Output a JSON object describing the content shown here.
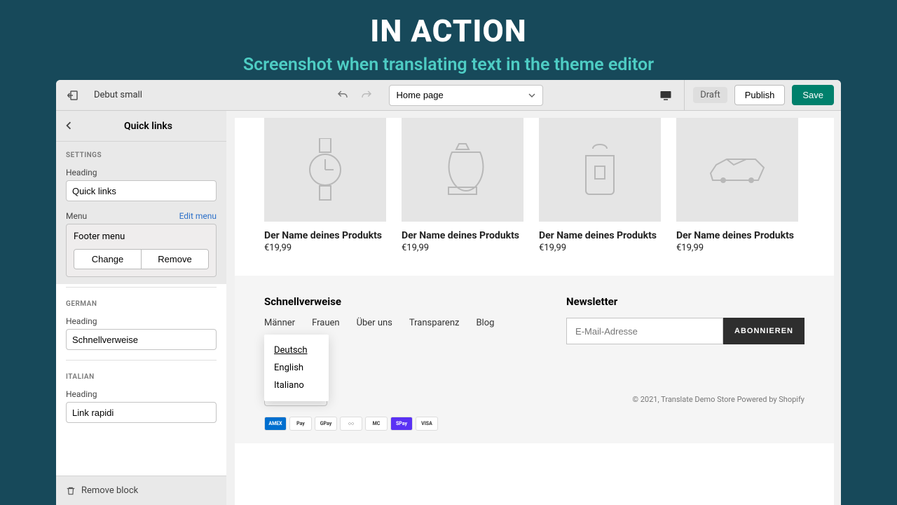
{
  "hero": {
    "title": "IN ACTION",
    "subtitle": "Screenshot when translating text in the theme editor"
  },
  "topbar": {
    "theme": "Debut small",
    "page": "Home page",
    "draft": "Draft",
    "publish": "Publish",
    "save": "Save"
  },
  "sidebar": {
    "title": "Quick links",
    "settings_label": "SETTINGS",
    "heading_label": "Heading",
    "heading_value": "Quick links",
    "menu_label": "Menu",
    "edit_menu": "Edit menu",
    "menu_name": "Footer menu",
    "change": "Change",
    "remove": "Remove",
    "german_label": "GERMAN",
    "german_heading": "Heading",
    "german_value": "Schnellverweise",
    "italian_label": "ITALIAN",
    "italian_heading": "Heading",
    "italian_value": "Link rapidi",
    "remove_block": "Remove block"
  },
  "products": [
    {
      "title": "Der Name deines Produkts",
      "price": "€19,99"
    },
    {
      "title": "Der Name deines Produkts",
      "price": "€19,99"
    },
    {
      "title": "Der Name deines Produkts",
      "price": "€19,99"
    },
    {
      "title": "Der Name deines Produkts",
      "price": "€19,99"
    }
  ],
  "footer": {
    "links_title": "Schnellverweise",
    "links": [
      "Männer",
      "Frauen",
      "Über uns",
      "Transparenz",
      "Blog"
    ],
    "newsletter_title": "Newsletter",
    "email_placeholder": "E-Mail-Adresse",
    "subscribe": "ABONNIEREN",
    "languages": [
      "Deutsch",
      "English",
      "Italiano"
    ],
    "current_lang": "Deutsch",
    "copyright": "© 2021, Translate Demo Store Powered by Shopify"
  },
  "pay": [
    "AMEX",
    "Pay",
    "GPay",
    "○○",
    "MC",
    "SPay",
    "VISA"
  ],
  "pay_colors": [
    "#006fcf",
    "#fff",
    "#fff",
    "#fff",
    "#fff",
    "#5a31f4",
    "#fff"
  ]
}
